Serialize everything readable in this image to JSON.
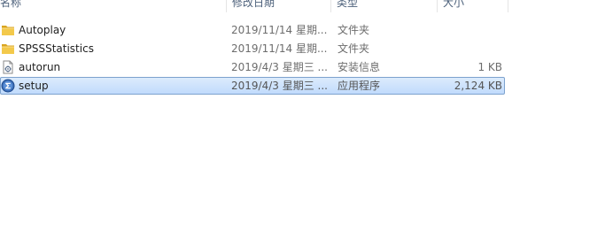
{
  "columns": {
    "name": "名称",
    "date_modified": "修改日期",
    "type": "类型",
    "size": "大小"
  },
  "files": [
    {
      "name": "Autoplay",
      "date_modified": "2019/11/14 星期...",
      "type": "文件夹",
      "size": "",
      "icon": "folder-icon",
      "selected": false
    },
    {
      "name": "SPSSStatistics",
      "date_modified": "2019/11/14 星期...",
      "type": "文件夹",
      "size": "",
      "icon": "folder-icon",
      "selected": false
    },
    {
      "name": "autorun",
      "date_modified": "2019/4/3 星期三 ...",
      "type": "安装信息",
      "size": "1 KB",
      "icon": "settings-file-icon",
      "selected": false
    },
    {
      "name": "setup",
      "date_modified": "2019/4/3 星期三 ...",
      "type": "应用程序",
      "size": "2,124 KB",
      "icon": "application-icon",
      "selected": true
    }
  ],
  "colors": {
    "selection_fill": "#c9dffb",
    "selection_border": "#7da2ce",
    "folder": "#e8b93b",
    "header_text": "#4c607a"
  }
}
